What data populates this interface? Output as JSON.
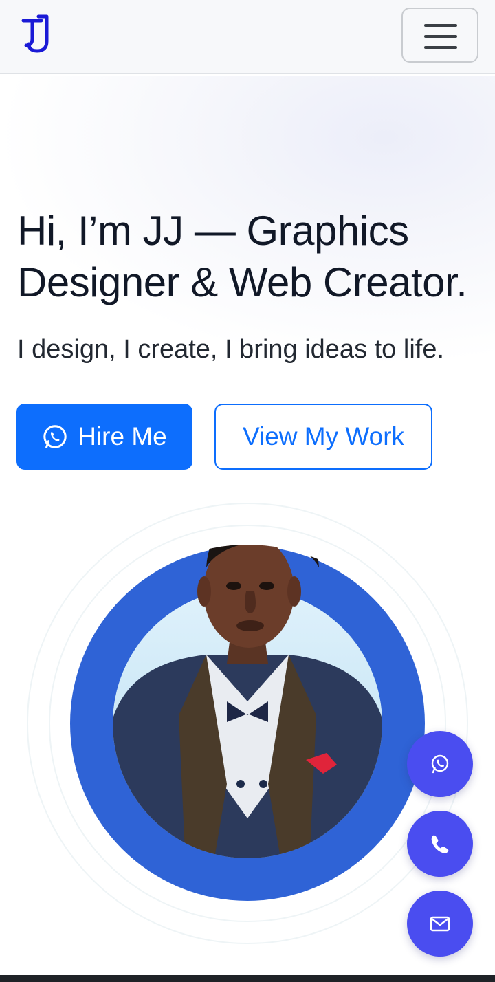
{
  "brand": {
    "logo_icon": "jj-monogram-logo",
    "accent": "#1a1ad6"
  },
  "nav": {
    "toggler_icon": "hamburger-menu-icon"
  },
  "hero": {
    "headline": "Hi, I’m JJ — Graphics Designer & Web Creator.",
    "subtext": "I design, I create, I bring ideas to life.",
    "hire_button": "Hire Me",
    "hire_icon": "whatsapp-icon",
    "work_button": "View My Work"
  },
  "portrait": {
    "ring_color": "#2f63d6",
    "icon": "profile-photo"
  },
  "floating_actions": [
    {
      "name": "whatsapp",
      "icon": "whatsapp-icon"
    },
    {
      "name": "phone",
      "icon": "phone-icon"
    },
    {
      "name": "email",
      "icon": "envelope-icon"
    }
  ],
  "colors": {
    "primary": "#0d6efd",
    "fab": "#4a4df0"
  }
}
